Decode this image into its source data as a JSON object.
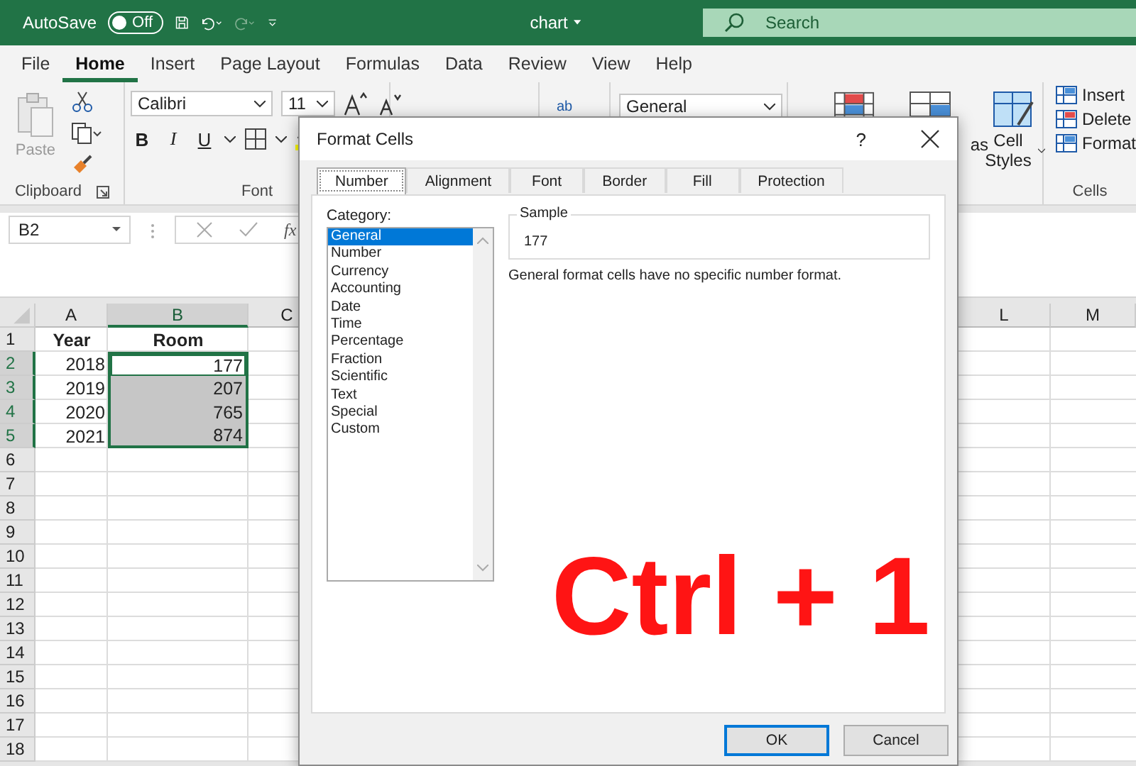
{
  "title_bar": {
    "autosave_label": "AutoSave",
    "autosave": {
      "on": false,
      "label": "Off"
    },
    "document": "chart",
    "search": {
      "placeholder": "Search"
    }
  },
  "menu_tabs": [
    {
      "label": "File",
      "selected": false
    },
    {
      "label": "Home",
      "selected": true
    },
    {
      "label": "Insert",
      "selected": false
    },
    {
      "label": "Page Layout",
      "selected": false
    },
    {
      "label": "Formulas",
      "selected": false
    },
    {
      "label": "Data",
      "selected": false
    },
    {
      "label": "Review",
      "selected": false
    },
    {
      "label": "View",
      "selected": false
    },
    {
      "label": "Help",
      "selected": false
    }
  ],
  "ribbon": {
    "clipboard": {
      "paste": "Paste",
      "label": "Clipboard"
    },
    "font": {
      "name": "Calibri",
      "size": "11",
      "bold": "B",
      "italic": "I",
      "underline": "U",
      "label": "Font"
    },
    "wrap": "ab",
    "number_format": "General",
    "styles": {
      "table_fragment": "as",
      "cell_styles": "Cell Styles"
    },
    "cells": {
      "items": [
        "Insert",
        "Delete",
        "Format"
      ],
      "label": "Cells"
    }
  },
  "formula_bar": {
    "name_box": "B2",
    "fx": "fx"
  },
  "sheet": {
    "columns": [
      {
        "label": "A",
        "selected": false
      },
      {
        "label": "B",
        "selected": true
      },
      {
        "label": "C",
        "selected": false
      },
      {
        "label": "L",
        "selected": false
      },
      {
        "label": "M",
        "selected": false
      }
    ],
    "rows": [
      {
        "number": "1",
        "kind": "header",
        "selected": false,
        "active": false,
        "cells": [
          "Year",
          "Room"
        ]
      },
      {
        "number": "2",
        "kind": "data",
        "selected": true,
        "active": true,
        "cells": [
          "2018",
          "177"
        ]
      },
      {
        "number": "3",
        "kind": "data",
        "selected": true,
        "active": false,
        "cells": [
          "2019",
          "207"
        ]
      },
      {
        "number": "4",
        "kind": "data",
        "selected": true,
        "active": false,
        "cells": [
          "2020",
          "765"
        ]
      },
      {
        "number": "5",
        "kind": "data",
        "selected": true,
        "active": false,
        "cells": [
          "2021",
          "874"
        ]
      },
      {
        "number": "6",
        "kind": "blank",
        "selected": false
      },
      {
        "number": "7",
        "kind": "blank",
        "selected": false
      },
      {
        "number": "8",
        "kind": "blank",
        "selected": false
      },
      {
        "number": "9",
        "kind": "blank",
        "selected": false
      },
      {
        "number": "10",
        "kind": "blank",
        "selected": false
      },
      {
        "number": "11",
        "kind": "blank",
        "selected": false
      },
      {
        "number": "12",
        "kind": "blank",
        "selected": false
      },
      {
        "number": "13",
        "kind": "blank",
        "selected": false
      },
      {
        "number": "14",
        "kind": "blank",
        "selected": false
      },
      {
        "number": "15",
        "kind": "blank",
        "selected": false
      },
      {
        "number": "16",
        "kind": "blank",
        "selected": false
      },
      {
        "number": "17",
        "kind": "blank",
        "selected": false
      },
      {
        "number": "18",
        "kind": "blank",
        "selected": false
      }
    ]
  },
  "dialog": {
    "title": "Format Cells",
    "help": "?",
    "tabs": [
      {
        "label": "Number",
        "selected": true
      },
      {
        "label": "Alignment",
        "selected": false
      },
      {
        "label": "Font",
        "selected": false
      },
      {
        "label": "Border",
        "selected": false
      },
      {
        "label": "Fill",
        "selected": false
      },
      {
        "label": "Protection",
        "selected": false
      }
    ],
    "category_label": "Category:",
    "categories": [
      {
        "label": "General",
        "selected": true
      },
      {
        "label": "Number",
        "selected": false
      },
      {
        "label": "Currency",
        "selected": false
      },
      {
        "label": "Accounting",
        "selected": false
      },
      {
        "label": "Date",
        "selected": false
      },
      {
        "label": "Time",
        "selected": false
      },
      {
        "label": "Percentage",
        "selected": false
      },
      {
        "label": "Fraction",
        "selected": false
      },
      {
        "label": "Scientific",
        "selected": false
      },
      {
        "label": "Text",
        "selected": false
      },
      {
        "label": "Special",
        "selected": false
      },
      {
        "label": "Custom",
        "selected": false
      }
    ],
    "sample_label": "Sample",
    "sample_value": "177",
    "description": "General format cells have no specific number format.",
    "buttons": [
      {
        "label": "OK",
        "default": true
      },
      {
        "label": "Cancel",
        "default": false
      }
    ]
  },
  "annotation": {
    "text": "Ctrl + 1"
  }
}
